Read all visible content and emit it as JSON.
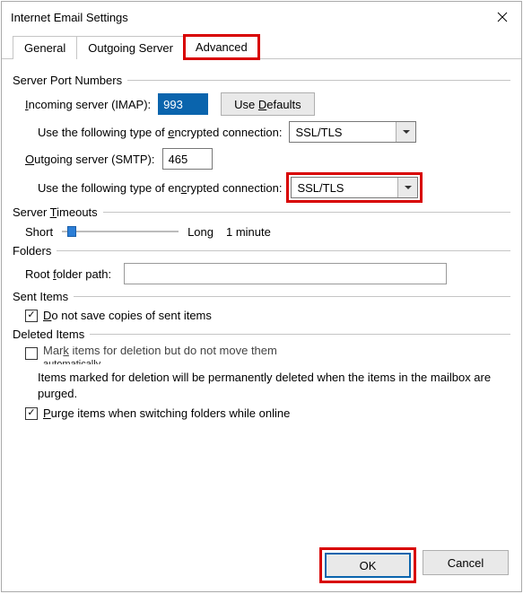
{
  "window": {
    "title": "Internet Email Settings"
  },
  "tabs": {
    "general": "General",
    "outgoing": "Outgoing Server",
    "advanced": "Advanced"
  },
  "portNumbers": {
    "heading": "Server Port Numbers",
    "incoming_label_pre": "I",
    "incoming_label_post": "ncoming server (IMAP):",
    "incoming_value": "993",
    "defaults_label_pre": "Use ",
    "defaults_label_u": "D",
    "defaults_label_post": "efaults",
    "enc_label_pre": "Use the following type of ",
    "enc_label_u": "e",
    "enc_label_post": "ncrypted connection:",
    "incoming_enc_value": "SSL/TLS",
    "outgoing_label_pre": "O",
    "outgoing_label_post": "utgoing server (SMTP):",
    "outgoing_value": "465",
    "enc2_label_pre": "Use the following type of en",
    "enc2_label_u": "c",
    "enc2_label_post": "rypted connection:",
    "outgoing_enc_value": "SSL/TLS"
  },
  "timeouts": {
    "heading_pre": "Server ",
    "heading_u": "T",
    "heading_post": "imeouts",
    "short": "Short",
    "long": "Long",
    "value": "1 minute"
  },
  "folders": {
    "heading": "Folders",
    "root_label_pre": "Root ",
    "root_label_u": "f",
    "root_label_post": "older path:",
    "root_value": ""
  },
  "sent": {
    "heading": "Sent Items",
    "label_pre": "D",
    "label_post": "o not save copies of sent items"
  },
  "deleted": {
    "heading": "Deleted Items",
    "mark_label_pre": "Mar",
    "mark_label_u": "k",
    "mark_label_post": " items for deletion but do not move them",
    "mark_label_line2": "automatically",
    "note": "Items marked for deletion will be permanently deleted when the items in the mailbox are purged.",
    "purge_label_pre": "P",
    "purge_label_post": "urge items when switching folders while online"
  },
  "buttons": {
    "ok": "OK",
    "cancel": "Cancel"
  }
}
